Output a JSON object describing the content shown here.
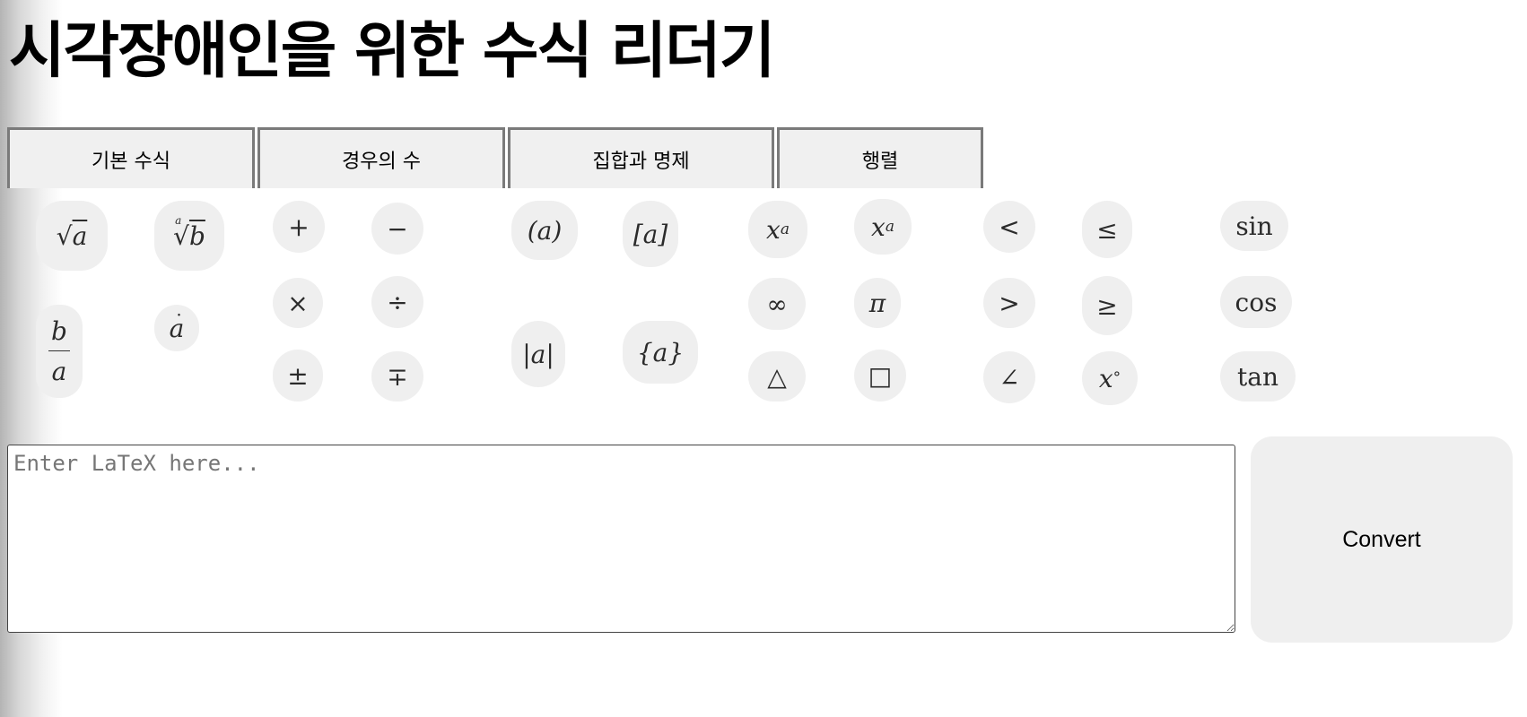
{
  "title": "시각장애인을 위한 수식 리더기",
  "tabs": [
    {
      "label": "기본 수식"
    },
    {
      "label": "경우의 수"
    },
    {
      "label": "집합과 명제"
    },
    {
      "label": "행렬"
    }
  ],
  "symbols": {
    "sqrt": {
      "base": "a"
    },
    "nth_root": {
      "index": "a",
      "base": "b"
    },
    "fraction": {
      "numerator": "b",
      "denominator": "a"
    },
    "dot": {
      "base": "a"
    },
    "plus": "+",
    "minus": "−",
    "times": "×",
    "divide": "÷",
    "plus_minus": "±",
    "minus_plus": "∓",
    "parentheses": "(a)",
    "brackets": "[a]",
    "absolute": "|a|",
    "braces": "{a}",
    "superscript": {
      "base": "x",
      "exp": "a"
    },
    "subscript": {
      "base": "x",
      "sub": "a"
    },
    "infinity": "∞",
    "pi": "π",
    "triangle": "△",
    "square": "□",
    "less_than": "<",
    "less_equal": "≤",
    "greater_than": ">",
    "greater_equal": "≥",
    "angle": "∠",
    "degree": {
      "base": "x",
      "exp": "°"
    },
    "sin": "sin",
    "cos": "cos",
    "tan": "tan"
  },
  "editor": {
    "placeholder": "Enter LaTeX here..."
  },
  "convert_label": "Convert"
}
